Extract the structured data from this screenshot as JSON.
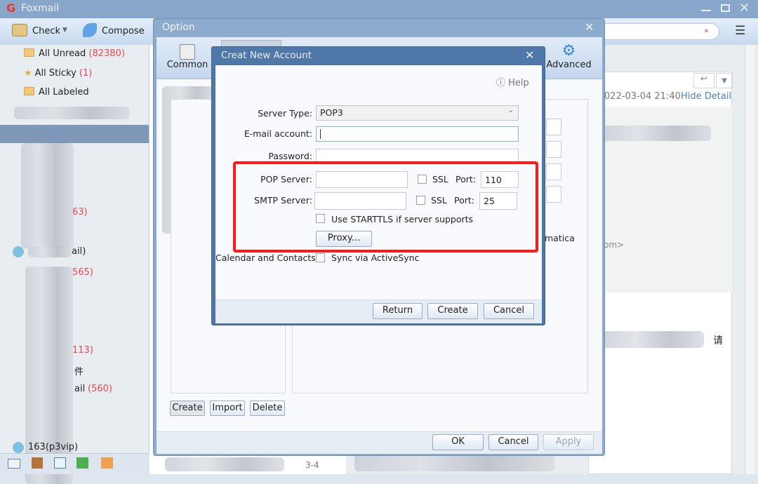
{
  "app": {
    "title": "Foxmail",
    "accent": "#e23a2f"
  },
  "toolbar": {
    "check_label": "Check",
    "compose_label": "Compose"
  },
  "sidebar": {
    "items": [
      {
        "label": "All Unread",
        "count": "(82380)",
        "icon": "folder-icon"
      },
      {
        "label": "All Sticky",
        "count": "(1)",
        "icon": "star-icon"
      },
      {
        "label": "All Labeled",
        "icon": "label-icon"
      }
    ],
    "partial": [
      "63)",
      "ail)",
      "565)",
      "113)",
      "件",
      "ail",
      "(560)",
      "163(p3vip)"
    ],
    "bottom_icons": [
      "mail-icon",
      "contacts-icon",
      "calendar-icon",
      "notes-icon",
      "rss-icon"
    ]
  },
  "reading": {
    "date": "022-03-04 21:40",
    "hide_detail": "Hide Detail",
    "fragment1": "om>",
    "fragment2": "请",
    "list_date": "3-4"
  },
  "option": {
    "title": "Option",
    "tabs": [
      {
        "label": "Common"
      },
      {
        "label": "Advanced"
      }
    ],
    "fragment": "matica",
    "create": "Create",
    "import": "Import",
    "delete": "Delete",
    "ok": "OK",
    "cancel": "Cancel",
    "apply": "Apply"
  },
  "new_account": {
    "title": "Creat New Account",
    "help": "Help",
    "server_type_label": "Server Type:",
    "server_type": "POP3",
    "email_label": "E-mail account:",
    "email": "",
    "password_label": "Password:",
    "pop_label": "POP Server:",
    "pop": "",
    "smtp_label": "SMTP Server:",
    "smtp": "",
    "ssl_label": "SSL",
    "port_label": "Port:",
    "pop_port": "110",
    "smtp_port": "25",
    "starttls": "Use STARTTLS if server supports",
    "proxy": "Proxy...",
    "calendar_label": "Calendar and Contacts:",
    "sync": "Sync via ActiveSync",
    "return": "Return",
    "create": "Create",
    "cancel": "Cancel",
    "highlight_color": "#ff1a1a"
  }
}
